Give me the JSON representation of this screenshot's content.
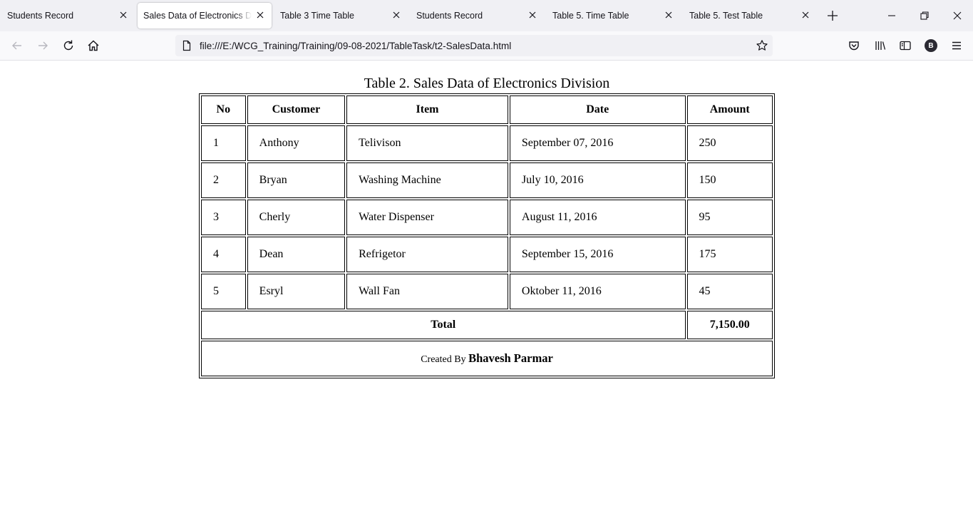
{
  "tabs": [
    {
      "label": "Students Record",
      "active": false
    },
    {
      "label": "Sales Data of Electronics Division",
      "active": true
    },
    {
      "label": "Table 3 Time Table",
      "active": false
    },
    {
      "label": "Students Record",
      "active": false
    },
    {
      "label": "Table 5. Time Table",
      "active": false
    },
    {
      "label": "Table 5. Test Table",
      "active": false
    }
  ],
  "address_bar": {
    "url": "file:///E:/WCG_Training/Training/09-08-2021/TableTask/t2-SalesData.html"
  },
  "profile": {
    "initial": "B"
  },
  "table": {
    "caption": "Table 2. Sales Data of Electronics Division",
    "headers": {
      "no": "No",
      "customer": "Customer",
      "item": "Item",
      "date": "Date",
      "amount": "Amount"
    },
    "rows": [
      {
        "no": "1",
        "customer": "Anthony",
        "item": "Telivison",
        "date": "September 07, 2016",
        "amount": "250"
      },
      {
        "no": "2",
        "customer": "Bryan",
        "item": "Washing Machine",
        "date": "July 10, 2016",
        "amount": "150"
      },
      {
        "no": "3",
        "customer": "Cherly",
        "item": "Water Dispenser",
        "date": "August 11, 2016",
        "amount": "95"
      },
      {
        "no": "4",
        "customer": "Dean",
        "item": "Refrigetor",
        "date": "September 15, 2016",
        "amount": "175"
      },
      {
        "no": "5",
        "customer": "Esryl",
        "item": "Wall Fan",
        "date": "Oktober 11, 2016",
        "amount": "45"
      }
    ],
    "total_label": "Total",
    "total_value": "7,150.00",
    "footer": {
      "prefix": "Created By",
      "author": "Bhavesh Parmar"
    }
  }
}
